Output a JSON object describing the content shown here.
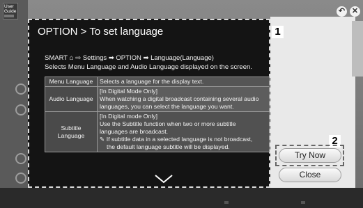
{
  "guide_logo": {
    "line1": "User",
    "line2": "Guide"
  },
  "top_buttons": {
    "back_glyph": "↶",
    "close_glyph": "✕"
  },
  "popup": {
    "title": "OPTION > To set language",
    "badge_1": "1",
    "intro_prefix": "SMART",
    "intro_path": "⇨ Settings ➡ OPTION ➡ Language(Language)",
    "intro_line2": "Selects Menu Language and Audio Language displayed on the screen.",
    "rows": [
      {
        "label": "Menu Language",
        "desc": [
          "Selects a language for the display text."
        ]
      },
      {
        "label": "Audio Language",
        "desc": [
          "[In Digital Mode Only]",
          "When watching a digital broadcast containing several audio",
          "languages, you can select the language you want."
        ]
      },
      {
        "label": "Subtitle Language",
        "desc": [
          "[In Digital mode Only]",
          "Use the Subtitle function when two or more subtitle",
          "languages are broadcast."
        ],
        "note": [
          "✎ If subtitle data in a selected language is not broadcast,",
          "the default language subtitle will be displayed."
        ]
      }
    ]
  },
  "side": {
    "badge_2": "2",
    "try_now": "Try Now",
    "close": "Close"
  }
}
